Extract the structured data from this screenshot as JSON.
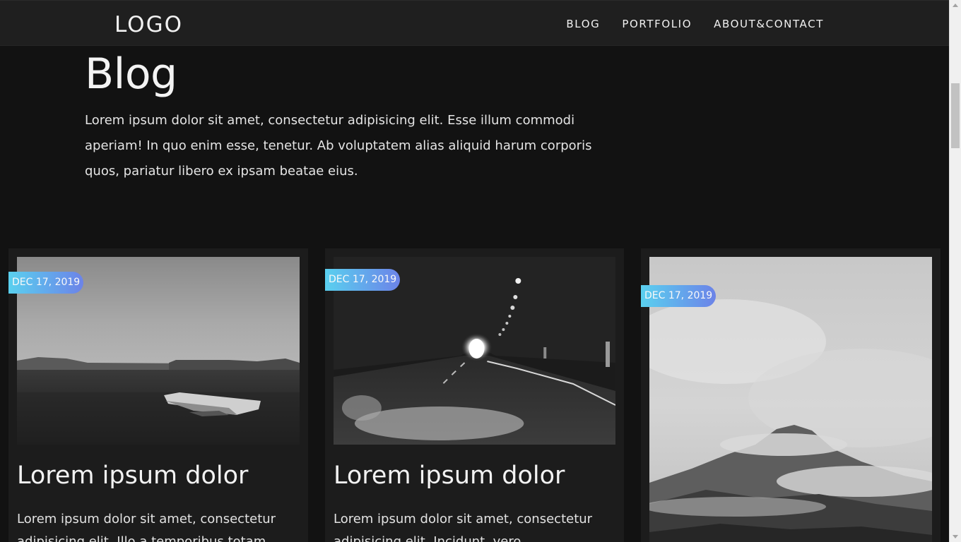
{
  "nav": {
    "logo": "LOGO",
    "links": [
      "BLOG",
      "PORTFOLIO",
      "ABOUT&CONTACT"
    ]
  },
  "hero": {
    "title": "Blog",
    "intro": "Lorem ipsum dolor sit amet, consectetur adipisicing elit. Esse illum commodi aperiam! In quo enim esse, tenetur. Ab voluptatem alias aliquid harum corporis quos, pariatur libero ex ipsam beatae eius."
  },
  "posts": [
    {
      "date": "DEC 17, 2019",
      "image": "wrecked-plane-landscape",
      "title": "Lorem ipsum dolor",
      "excerpt": "Lorem ipsum dolor sit amet, consectetur adipisicing elit. Illo a temporibus totam"
    },
    {
      "date": "DEC 17, 2019",
      "image": "road-tunnel",
      "title": "Lorem ipsum dolor",
      "excerpt": "Lorem ipsum dolor sit amet, consectetur adipisicing elit. Incidunt, vero"
    },
    {
      "date": "DEC 17, 2019",
      "image": "misty-mountain",
      "title": "",
      "excerpt": ""
    }
  ]
}
